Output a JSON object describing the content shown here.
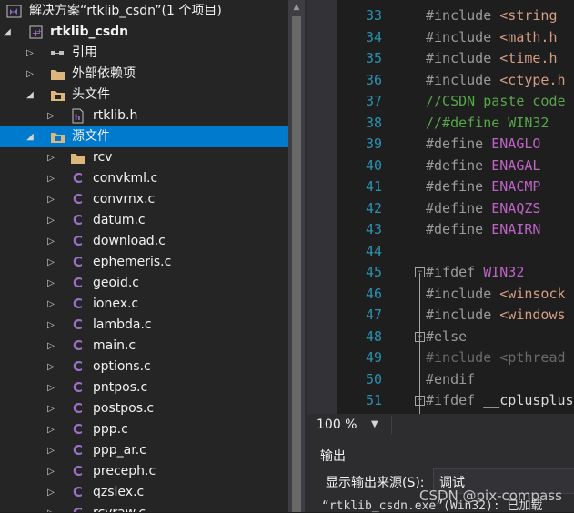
{
  "solution_explorer": {
    "solution_label": "解决方案“rtklib_csdn”(1 个项目)",
    "project": "rtklib_csdn",
    "nodes": {
      "references": "引用",
      "external_deps": "外部依赖项",
      "headers": "头文件",
      "header_file": "rtklib.h",
      "sources": "源文件",
      "rcv": "rcv"
    },
    "source_files": [
      "convkml.c",
      "convrnx.c",
      "datum.c",
      "download.c",
      "ephemeris.c",
      "geoid.c",
      "ionex.c",
      "lambda.c",
      "main.c",
      "options.c",
      "pntpos.c",
      "postpos.c",
      "ppp.c",
      "ppp_ar.c",
      "preceph.c",
      "qzslex.c",
      "rcvraw.c"
    ]
  },
  "editor": {
    "line_numbers": [
      "33",
      "34",
      "35",
      "36",
      "37",
      "38",
      "39",
      "40",
      "41",
      "42",
      "43",
      "44",
      "45",
      "46",
      "47",
      "48",
      "49",
      "50",
      "51"
    ],
    "lines": [
      {
        "pp": "#include ",
        "rest": "<string",
        "cls": "str"
      },
      {
        "pp": "#include ",
        "rest": "<math.h",
        "cls": "str"
      },
      {
        "pp": "#include ",
        "rest": "<time.h",
        "cls": "str"
      },
      {
        "pp": "#include ",
        "rest": "<ctype.h",
        "cls": "str"
      },
      {
        "pp": "",
        "rest": "//CSDN paste code",
        "cls": "cmt"
      },
      {
        "pp": "",
        "rest": "//#define WIN32",
        "cls": "cmt"
      },
      {
        "pp": "#define ",
        "rest": "ENAGLO",
        "cls": "mac"
      },
      {
        "pp": "#define ",
        "rest": "ENAGAL",
        "cls": "mac"
      },
      {
        "pp": "#define ",
        "rest": "ENACMP",
        "cls": "mac"
      },
      {
        "pp": "#define ",
        "rest": "ENAQZS",
        "cls": "mac"
      },
      {
        "pp": "#define ",
        "rest": "ENAIRN",
        "cls": "mac"
      },
      {
        "pp": "",
        "rest": "",
        "cls": "ident"
      },
      {
        "pp": "#ifdef ",
        "rest": "WIN32",
        "cls": "mac"
      },
      {
        "pp": "#include ",
        "rest": "<winsock",
        "cls": "str"
      },
      {
        "pp": "#include ",
        "rest": "<windows",
        "cls": "str"
      },
      {
        "pp": "#else",
        "rest": "",
        "cls": "ident"
      },
      {
        "pp": "",
        "rest": "#include <pthread",
        "cls": "gray"
      },
      {
        "pp": "#endif",
        "rest": "",
        "cls": "ident"
      },
      {
        "pp": "#ifdef ",
        "rest": "__cplusplus",
        "cls": "ident"
      }
    ],
    "zoom": "100 %"
  },
  "output": {
    "title": "输出",
    "source_label": "显示输出来源(S):",
    "source_value": "调试",
    "text": "“rtklib_csdn.exe”(Win32): 已加载"
  },
  "watermark": "CSDN @pix-compass",
  "colors": {
    "selection": "#007acc",
    "explorer_bg": "#252526",
    "editor_bg": "#1e1e1e",
    "line_number": "#2b91af",
    "string": "#d69d85",
    "comment": "#57a64a",
    "macro": "#bd63c5"
  }
}
